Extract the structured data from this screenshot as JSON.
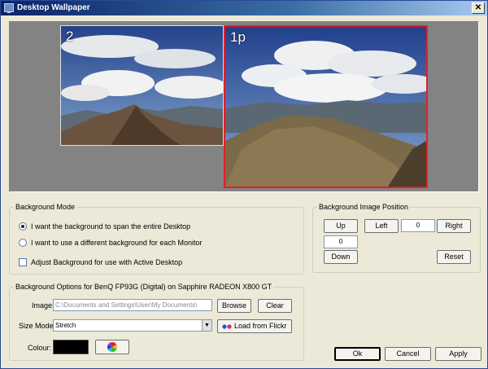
{
  "window": {
    "title": "Desktop Wallpaper",
    "close_glyph": "✕"
  },
  "preview": {
    "monitors": [
      {
        "id": "2",
        "label": "2",
        "selected": false
      },
      {
        "id": "1p",
        "label": "1p",
        "selected": true
      }
    ],
    "selected_border_color": "#e0202a"
  },
  "background_mode": {
    "legend": "Background Mode",
    "options": [
      {
        "label": "I want the background to span the entire Desktop",
        "selected": true
      },
      {
        "label": "I want to use a different background for each Monitor",
        "selected": false
      }
    ],
    "active_desktop_label": "Adjust Background for use with Active Desktop",
    "active_desktop_checked": false
  },
  "position": {
    "legend": "Background Image Position",
    "up_label": "Up",
    "down_label": "Down",
    "left_label": "Left",
    "right_label": "Right",
    "reset_label": "Reset",
    "x_value": "0",
    "y_value": "0"
  },
  "options": {
    "legend": "Background Options for BenQ FP93G (Digital) on Sapphire RADEON X800 GT",
    "image_label": "Image:",
    "image_value": "C:\\Documents and Settings\\User\\My Documents\\",
    "browse_label": "Browse",
    "clear_label": "Clear",
    "size_mode_label": "Size Mode:",
    "size_mode_value": "Stretch",
    "flickr_label": "Load from Flickr",
    "colour_label": "Colour:",
    "colour_value": "#000000"
  },
  "footer": {
    "ok_label": "Ok",
    "cancel_label": "Cancel",
    "apply_label": "Apply"
  }
}
